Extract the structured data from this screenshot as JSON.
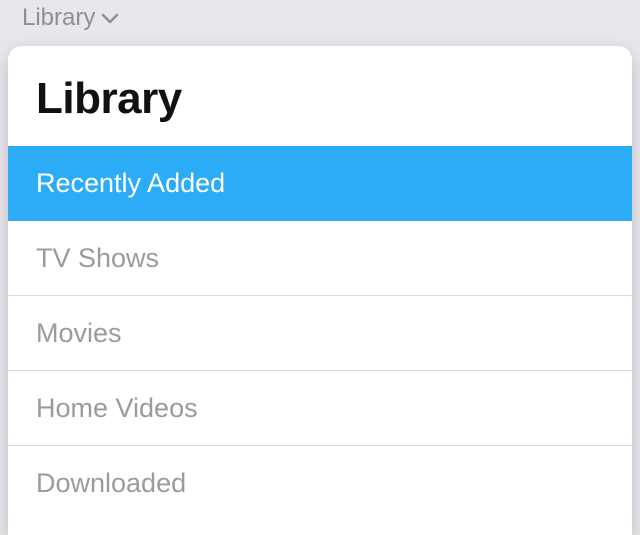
{
  "nav": {
    "trigger_label": "Library"
  },
  "panel": {
    "title": "Library",
    "menu": {
      "items": [
        {
          "label": "Recently Added",
          "selected": true
        },
        {
          "label": "TV Shows",
          "selected": false
        },
        {
          "label": "Movies",
          "selected": false
        },
        {
          "label": "Home Videos",
          "selected": false
        },
        {
          "label": "Downloaded",
          "selected": false
        }
      ]
    }
  }
}
